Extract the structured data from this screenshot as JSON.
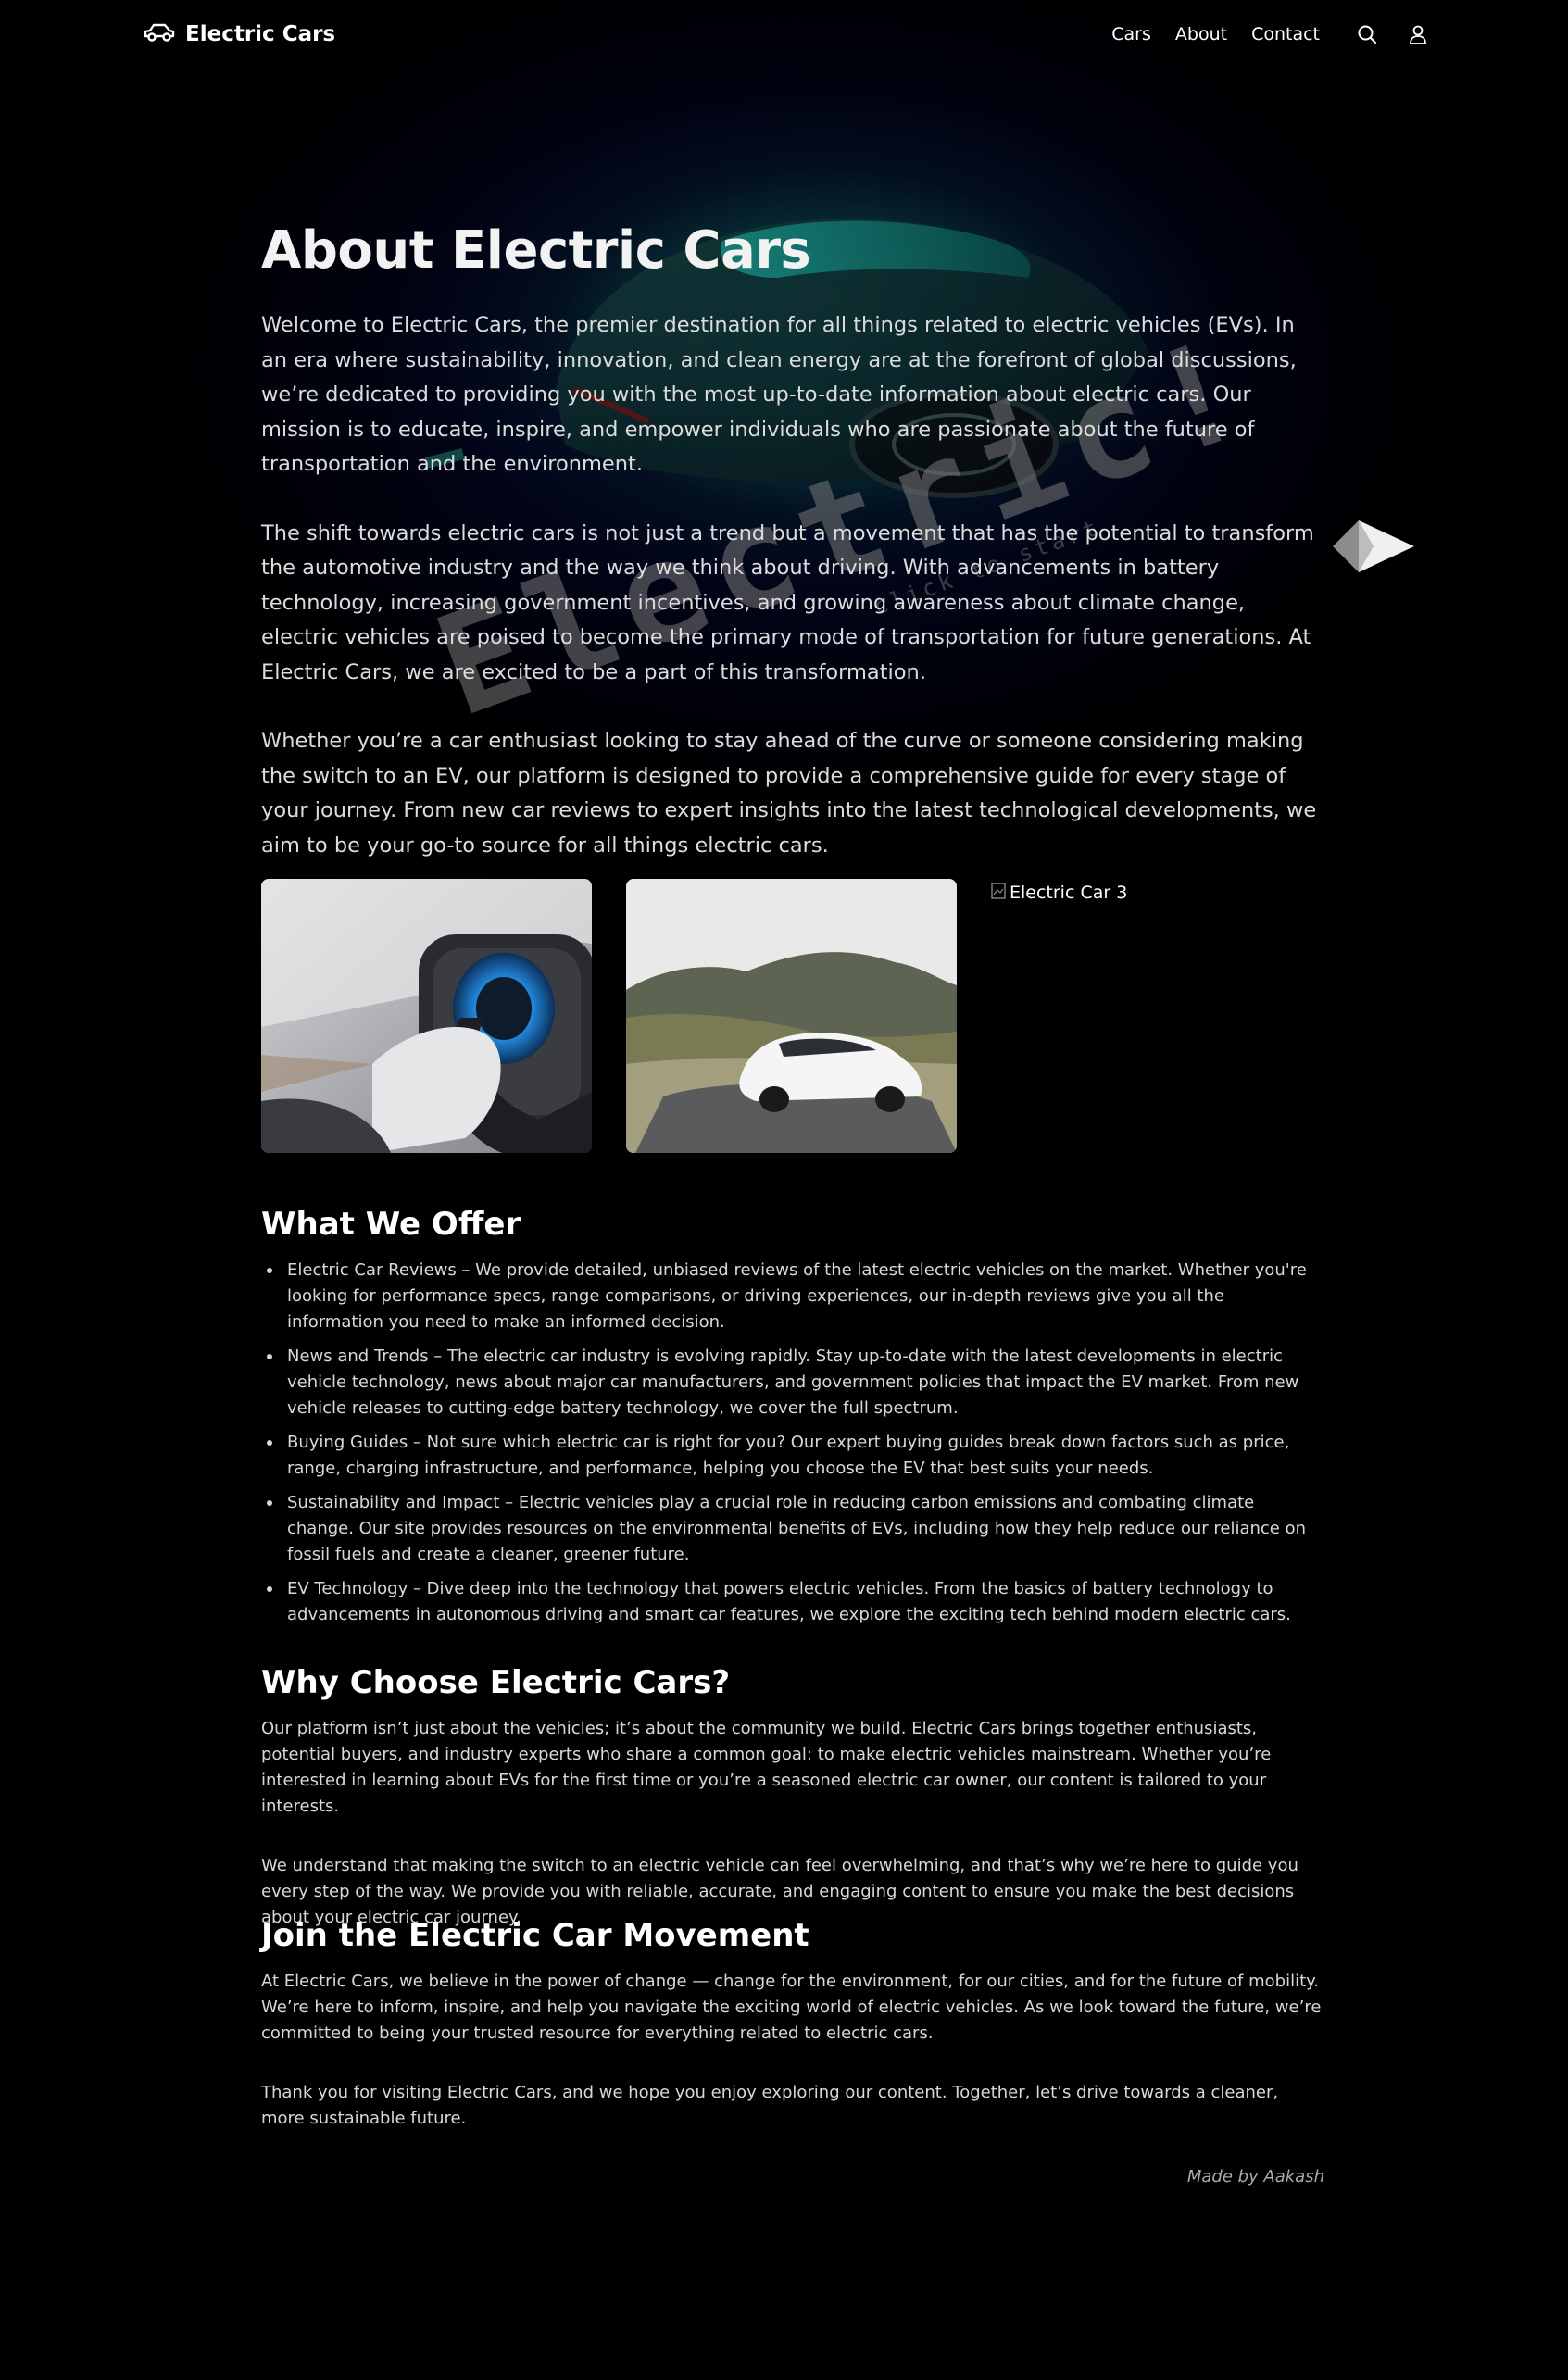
{
  "header": {
    "brand": "Electric Cars",
    "nav": [
      "Cars",
      "About",
      "Contact"
    ]
  },
  "hero": {
    "title": "About Electric Cars",
    "paragraphs": [
      "Welcome to Electric Cars, the premier destination for all things related to electric vehicles (EVs). In an era where sustainability, innovation, and clean energy are at the forefront of global discussions, we’re dedicated to providing you with the most up-to-date information about electric cars. Our mission is to educate, inspire, and empower individuals who are passionate about the future of transportation and the environment.",
      "The shift towards electric cars is not just a trend but a movement that has the potential to transform the automotive industry and the way we think about driving. With advancements in battery technology, increasing government incentives, and growing awareness about climate change, electric vehicles are poised to become the primary mode of transportation for future generations. At Electric Cars, we are excited to be a part of this transformation.",
      "Whether you’re a car enthusiast looking to stay ahead of the curve or someone considering making the switch to an EV, our platform is designed to provide a comprehensive guide for every stage of your journey. From new car reviews to expert insights into the latest technological developments, we aim to be your go-to source for all things electric cars."
    ],
    "background_word": "Electric!",
    "background_hint": "click to start"
  },
  "gallery": {
    "broken_image_alt": "Electric Car 3"
  },
  "offer": {
    "heading": "What We Offer",
    "items": [
      "Electric Car Reviews – We provide detailed, unbiased reviews of the latest electric vehicles on the market. Whether you're looking for performance specs, range comparisons, or driving experiences, our in-depth reviews give you all the information you need to make an informed decision.",
      "News and Trends – The electric car industry is evolving rapidly. Stay up-to-date with the latest developments in electric vehicle technology, news about major car manufacturers, and government policies that impact the EV market. From new vehicle releases to cutting-edge battery technology, we cover the full spectrum.",
      "Buying Guides – Not sure which electric car is right for you? Our expert buying guides break down factors such as price, range, charging infrastructure, and performance, helping you choose the EV that best suits your needs.",
      "Sustainability and Impact – Electric vehicles play a crucial role in reducing carbon emissions and combating climate change. Our site provides resources on the environmental benefits of EVs, including how they help reduce our reliance on fossil fuels and create a cleaner, greener future.",
      "EV Technology – Dive deep into the technology that powers electric vehicles. From the basics of battery technology to advancements in autonomous driving and smart car features, we explore the exciting tech behind modern electric cars."
    ]
  },
  "why": {
    "heading": "Why Choose Electric Cars?",
    "paragraphs": [
      "Our platform isn’t just about the vehicles; it’s about the community we build. Electric Cars brings together enthusiasts, potential buyers, and industry experts who share a common goal: to make electric vehicles mainstream. Whether you’re interested in learning about EVs for the first time or you’re a seasoned electric car owner, our content is tailored to your interests.",
      "We understand that making the switch to an electric vehicle can feel overwhelming, and that’s why we’re here to guide you every step of the way. We provide you with reliable, accurate, and engaging content to ensure you make the best decisions about your electric car journey."
    ]
  },
  "join": {
    "heading": "Join the Electric Car Movement",
    "paragraphs": [
      "At Electric Cars, we believe in the power of change — change for the environment, for our cities, and for the future of mobility. We’re here to inform, inspire, and help you navigate the exciting world of electric vehicles. As we look toward the future, we’re committed to being your trusted resource for everything related to electric cars.",
      "Thank you for visiting Electric Cars, and we hope you enjoy exploring our content. Together, let’s drive towards a cleaner, more sustainable future."
    ]
  },
  "footer": {
    "credit": "Made by Aakash"
  },
  "icons": [
    "car-icon",
    "search-icon",
    "user-icon",
    "next-arrow-icon"
  ],
  "colors": {
    "background": "#000000",
    "hero_glow": "#1a7d78",
    "text": "#e6e6e6",
    "credit": "#a9a9b5"
  }
}
